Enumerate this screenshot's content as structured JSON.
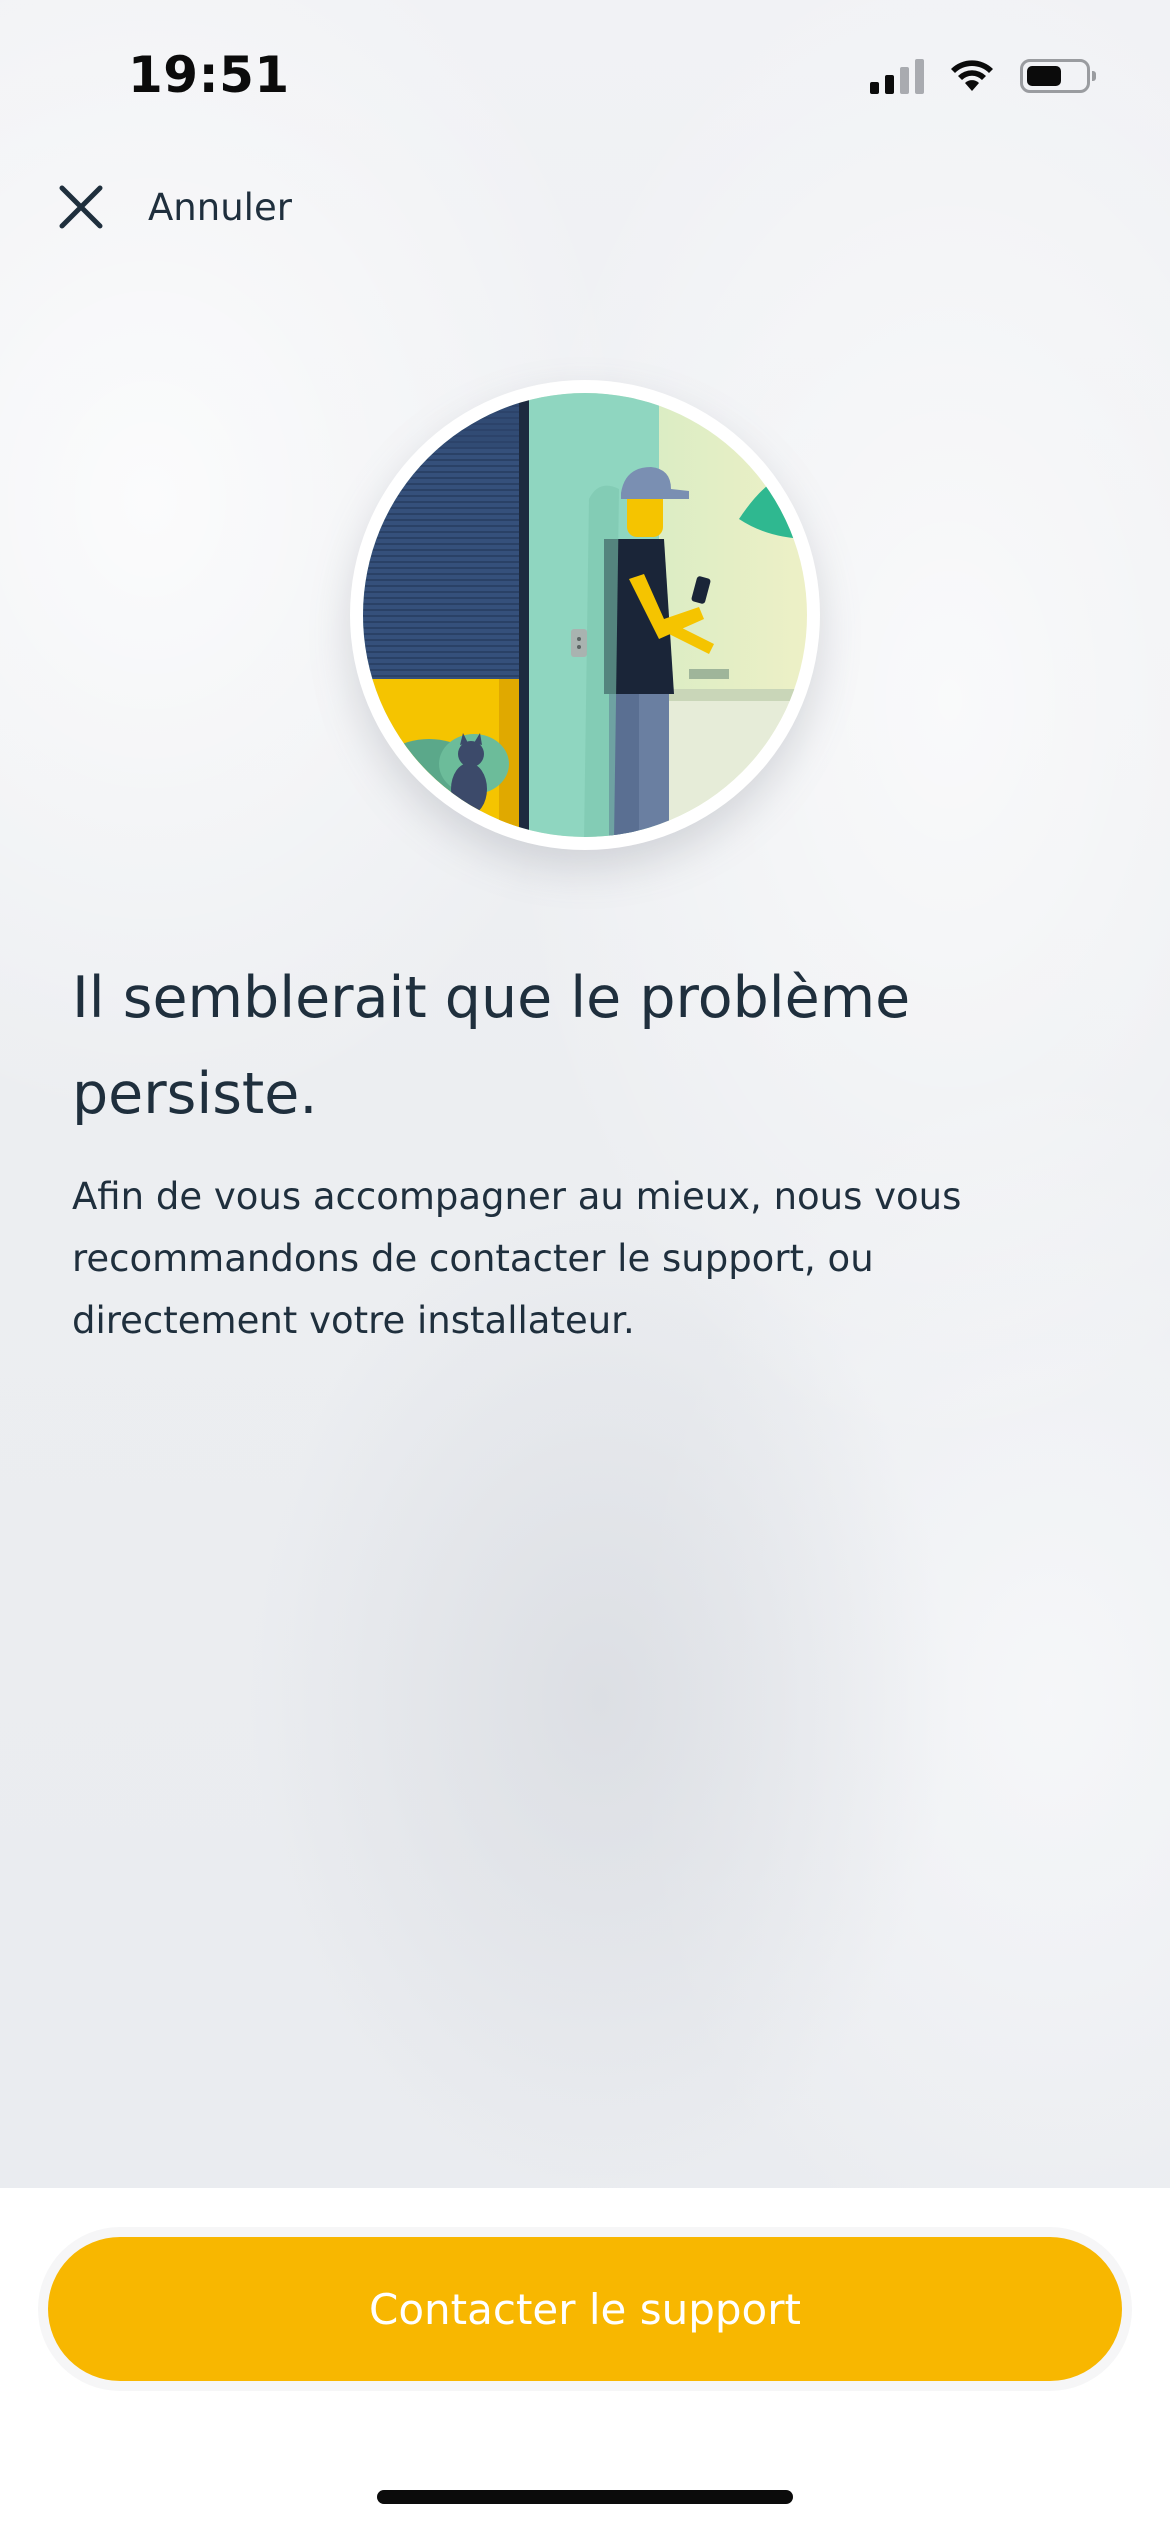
{
  "status_bar": {
    "time": "19:51",
    "signal_icon": "cellular-signal-icon",
    "wifi_icon": "wifi-icon",
    "battery_icon": "battery-icon",
    "battery_level": 0.6
  },
  "header": {
    "close_icon": "close-icon",
    "cancel_label": "Annuler"
  },
  "illustration": {
    "name": "installer-at-door-illustration"
  },
  "main": {
    "title": "Il semblerait que le problème persiste.",
    "body": "Afin de vous accompagner au mieux, nous vous recommandons de contacter le support, ou directement votre installateur."
  },
  "footer": {
    "contact_button_label": "Contacter le support"
  },
  "colors": {
    "accent": "#F8B700",
    "text": "#1F2F3D",
    "background": "#EEF0F3"
  }
}
